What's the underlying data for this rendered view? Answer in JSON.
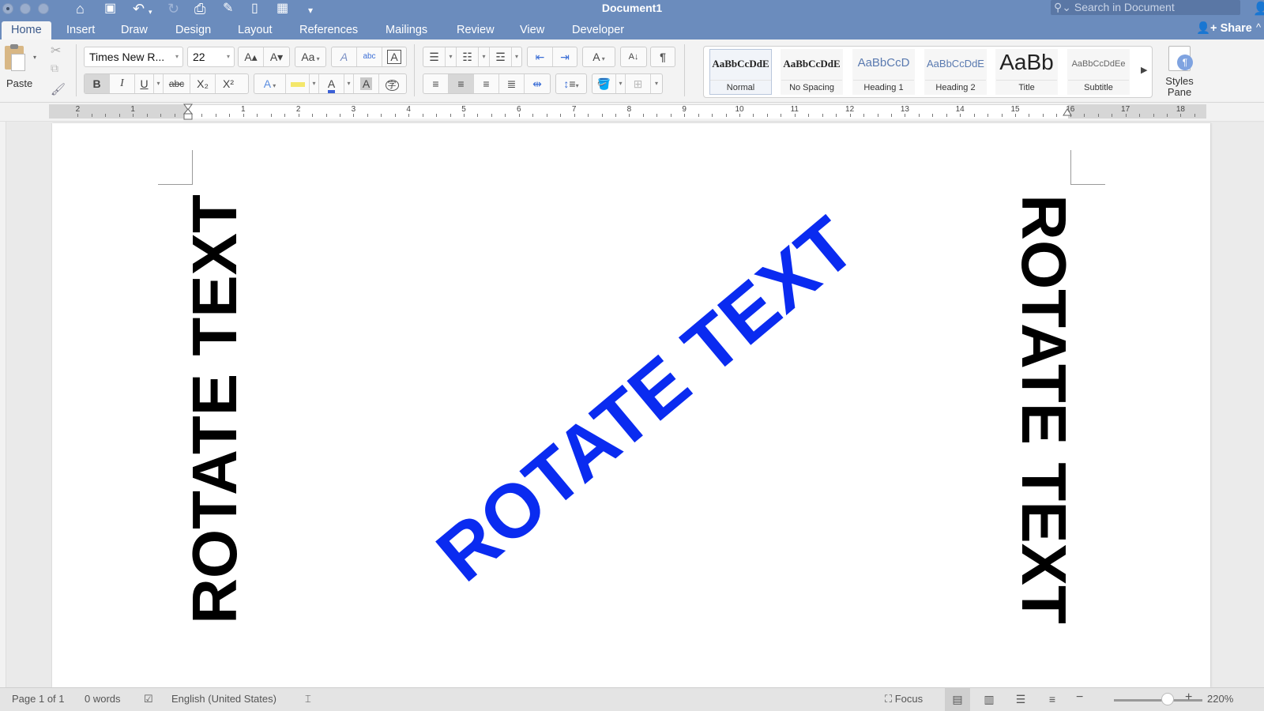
{
  "window": {
    "title": "Document1",
    "search_placeholder": "Search in Document"
  },
  "quick_access": [
    {
      "icon": "home-icon",
      "glyph": "⌂"
    },
    {
      "icon": "save-icon",
      "glyph": "💾"
    },
    {
      "icon": "undo-icon",
      "glyph": "↶"
    },
    {
      "icon": "redo-icon",
      "glyph": "↻"
    },
    {
      "icon": "print-icon",
      "glyph": "⎙"
    },
    {
      "icon": "edit-document-icon",
      "glyph": "✎"
    },
    {
      "icon": "new-document-icon",
      "glyph": "🗋"
    },
    {
      "icon": "form-icon",
      "glyph": "▦"
    },
    {
      "icon": "customize-toolbar-icon",
      "glyph": "⌄"
    }
  ],
  "tabs": [
    {
      "label": "Home",
      "active": true
    },
    {
      "label": "Insert"
    },
    {
      "label": "Draw"
    },
    {
      "label": "Design"
    },
    {
      "label": "Layout"
    },
    {
      "label": "References"
    },
    {
      "label": "Mailings"
    },
    {
      "label": "Review"
    },
    {
      "label": "View"
    },
    {
      "label": "Developer"
    }
  ],
  "share_label": "Share",
  "ribbon": {
    "paste_label": "Paste",
    "font_name": "Times New R...",
    "font_size": "22",
    "increase_font": "A▴",
    "decrease_font": "A▾",
    "bold": "B",
    "italic": "I",
    "underline": "U",
    "strikethrough": "abc",
    "subscript": "X₂",
    "superscript": "X²",
    "text_effects": "A",
    "font_color": "A",
    "char_shading": "A",
    "enclose_char": "字",
    "change_case": "Aa",
    "clear_format": "A",
    "phonetic": "abc",
    "char_border": "A",
    "pilcrow": "¶",
    "sort": "A↓",
    "font_color_hex": "#3b5fd6",
    "highlight_hex": "#f4e76b",
    "styles": [
      {
        "preview": "AaBbCcDdE",
        "name": "Normal",
        "selected": true
      },
      {
        "preview": "AaBbCcDdE",
        "name": "No Spacing"
      },
      {
        "preview": "AaBbCcD",
        "name": "Heading 1"
      },
      {
        "preview": "AaBbCcDdE",
        "name": "Heading 2"
      },
      {
        "preview": "AaBb",
        "name": "Title"
      },
      {
        "preview": "AaBbCcDdEe",
        "name": "Subtitle"
      }
    ],
    "styles_pane_line1": "Styles",
    "styles_pane_line2": "Pane"
  },
  "ruler": {
    "labels_left": [
      "2",
      "1"
    ],
    "labels_right": [
      "1",
      "2",
      "3",
      "4",
      "5",
      "6",
      "7",
      "8",
      "9",
      "10",
      "11",
      "12",
      "13",
      "14",
      "15",
      "16",
      "17",
      "18"
    ]
  },
  "document": {
    "left_text": "ROTATE TEXT",
    "diagonal_text": "ROTATE TEXT",
    "right_text": "ROTATE TEXT",
    "diagonal_color": "#0a2bf0",
    "vertical_color": "#000000"
  },
  "status": {
    "page": "Page 1 of 1",
    "words": "0 words",
    "language": "English (United States)",
    "focus": "Focus",
    "zoom": "220%",
    "zoom_percent": 220
  }
}
